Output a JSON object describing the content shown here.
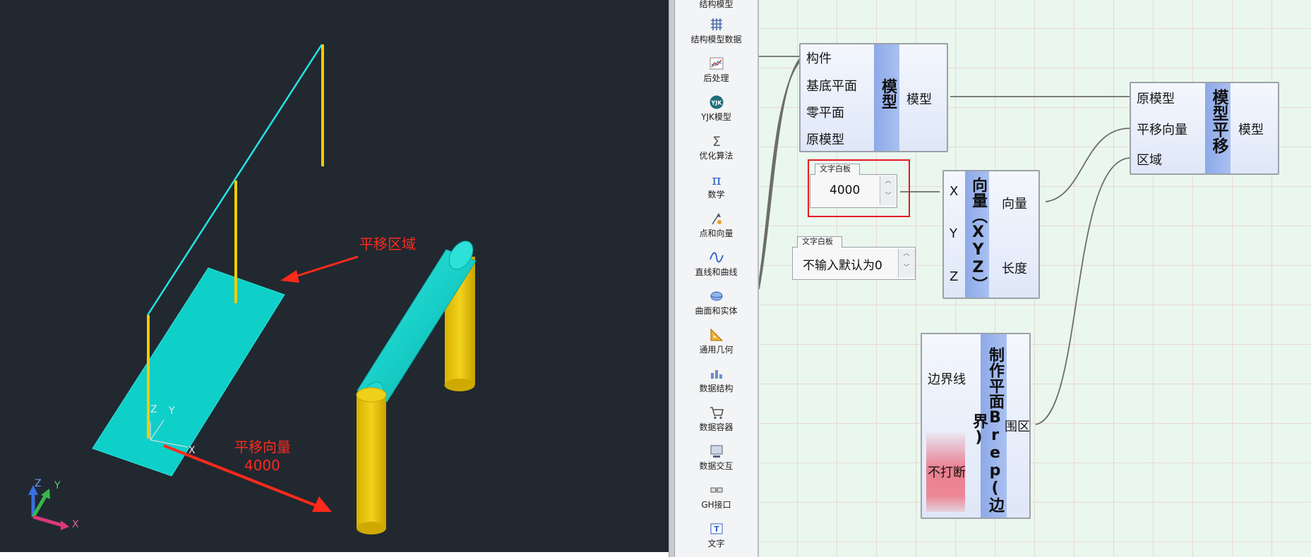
{
  "viewport": {
    "labels": {
      "region": "平移区域",
      "vector_line1": "平移向量",
      "vector_line2": "4000"
    },
    "local_axes": {
      "z": "Z",
      "y": "Y",
      "x": "X"
    },
    "triad": {
      "z": "Z",
      "y": "Y",
      "x": "X"
    }
  },
  "panel": {
    "items": [
      {
        "label": "结构模型",
        "icon": "structure-model-icon"
      },
      {
        "label": "结构模型数据",
        "icon": "grid-data-icon"
      },
      {
        "label": "后处理",
        "icon": "postprocess-chart-icon"
      },
      {
        "label": "YJK模型",
        "icon": "yjk-logo-icon"
      },
      {
        "label": "优化算法",
        "icon": "sigma-icon"
      },
      {
        "label": "数学",
        "icon": "pi-icon"
      },
      {
        "label": "点和向量",
        "icon": "point-vector-icon"
      },
      {
        "label": "直线和曲线",
        "icon": "curve-icon"
      },
      {
        "label": "曲面和实体",
        "icon": "surface-solid-icon"
      },
      {
        "label": "通用几何",
        "icon": "ruler-triangle-icon"
      },
      {
        "label": "数据结构",
        "icon": "data-structure-icon"
      },
      {
        "label": "数据容器",
        "icon": "cart-icon"
      },
      {
        "label": "数据交互",
        "icon": "data-exchange-icon"
      },
      {
        "label": "GH接口",
        "icon": "gh-interface-icon"
      },
      {
        "label": "文字",
        "icon": "text-icon"
      }
    ]
  },
  "canvas": {
    "model_node": {
      "title": "模型",
      "inputs": [
        "构件",
        "基底平面",
        "零平面",
        "原模型"
      ],
      "outputs": [
        "模型"
      ]
    },
    "translate_node": {
      "title": "模型平移",
      "inputs": [
        "原模型",
        "平移向量",
        "区域"
      ],
      "outputs": [
        "模型"
      ]
    },
    "vector_node": {
      "title": "向量（XYZ）",
      "inputs": [
        "X",
        "Y",
        "Z"
      ],
      "outputs": [
        "向量",
        "长度"
      ]
    },
    "plane_node": {
      "title": "制作平面Brep(边界)",
      "inputs": [
        "边界线",
        "不打断"
      ],
      "outputs": [
        "围区"
      ]
    },
    "text_panel_1": {
      "tab": "文字白板",
      "value": "4000"
    },
    "text_panel_2": {
      "tab": "文字白板",
      "value": "不输入默认为0"
    }
  },
  "colors": {
    "viewport_bg": "#212830",
    "cyan_surface": "#0fcfc9",
    "yellow_column": "#e6c200",
    "annotation_red": "#ff2a1c",
    "canvas_bg": "#eaf7ee",
    "node_strip": "#9bb5ec",
    "highlight_box": "#e8191f"
  }
}
